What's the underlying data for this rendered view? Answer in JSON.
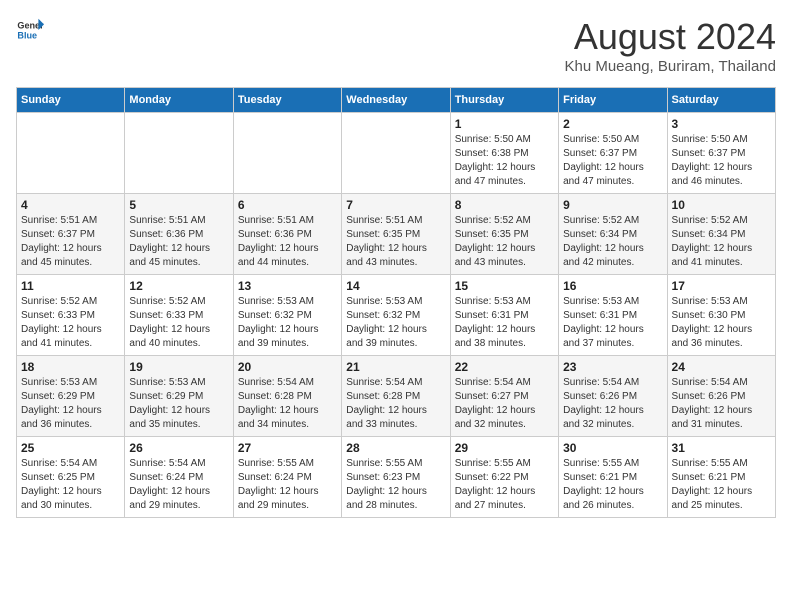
{
  "header": {
    "logo_general": "General",
    "logo_blue": "Blue",
    "month_title": "August 2024",
    "location": "Khu Mueang, Buriram, Thailand"
  },
  "weekdays": [
    "Sunday",
    "Monday",
    "Tuesday",
    "Wednesday",
    "Thursday",
    "Friday",
    "Saturday"
  ],
  "weeks": [
    [
      {
        "day": "",
        "info": ""
      },
      {
        "day": "",
        "info": ""
      },
      {
        "day": "",
        "info": ""
      },
      {
        "day": "",
        "info": ""
      },
      {
        "day": "1",
        "info": "Sunrise: 5:50 AM\nSunset: 6:38 PM\nDaylight: 12 hours\nand 47 minutes."
      },
      {
        "day": "2",
        "info": "Sunrise: 5:50 AM\nSunset: 6:37 PM\nDaylight: 12 hours\nand 47 minutes."
      },
      {
        "day": "3",
        "info": "Sunrise: 5:50 AM\nSunset: 6:37 PM\nDaylight: 12 hours\nand 46 minutes."
      }
    ],
    [
      {
        "day": "4",
        "info": "Sunrise: 5:51 AM\nSunset: 6:37 PM\nDaylight: 12 hours\nand 45 minutes."
      },
      {
        "day": "5",
        "info": "Sunrise: 5:51 AM\nSunset: 6:36 PM\nDaylight: 12 hours\nand 45 minutes."
      },
      {
        "day": "6",
        "info": "Sunrise: 5:51 AM\nSunset: 6:36 PM\nDaylight: 12 hours\nand 44 minutes."
      },
      {
        "day": "7",
        "info": "Sunrise: 5:51 AM\nSunset: 6:35 PM\nDaylight: 12 hours\nand 43 minutes."
      },
      {
        "day": "8",
        "info": "Sunrise: 5:52 AM\nSunset: 6:35 PM\nDaylight: 12 hours\nand 43 minutes."
      },
      {
        "day": "9",
        "info": "Sunrise: 5:52 AM\nSunset: 6:34 PM\nDaylight: 12 hours\nand 42 minutes."
      },
      {
        "day": "10",
        "info": "Sunrise: 5:52 AM\nSunset: 6:34 PM\nDaylight: 12 hours\nand 41 minutes."
      }
    ],
    [
      {
        "day": "11",
        "info": "Sunrise: 5:52 AM\nSunset: 6:33 PM\nDaylight: 12 hours\nand 41 minutes."
      },
      {
        "day": "12",
        "info": "Sunrise: 5:52 AM\nSunset: 6:33 PM\nDaylight: 12 hours\nand 40 minutes."
      },
      {
        "day": "13",
        "info": "Sunrise: 5:53 AM\nSunset: 6:32 PM\nDaylight: 12 hours\nand 39 minutes."
      },
      {
        "day": "14",
        "info": "Sunrise: 5:53 AM\nSunset: 6:32 PM\nDaylight: 12 hours\nand 39 minutes."
      },
      {
        "day": "15",
        "info": "Sunrise: 5:53 AM\nSunset: 6:31 PM\nDaylight: 12 hours\nand 38 minutes."
      },
      {
        "day": "16",
        "info": "Sunrise: 5:53 AM\nSunset: 6:31 PM\nDaylight: 12 hours\nand 37 minutes."
      },
      {
        "day": "17",
        "info": "Sunrise: 5:53 AM\nSunset: 6:30 PM\nDaylight: 12 hours\nand 36 minutes."
      }
    ],
    [
      {
        "day": "18",
        "info": "Sunrise: 5:53 AM\nSunset: 6:29 PM\nDaylight: 12 hours\nand 36 minutes."
      },
      {
        "day": "19",
        "info": "Sunrise: 5:53 AM\nSunset: 6:29 PM\nDaylight: 12 hours\nand 35 minutes."
      },
      {
        "day": "20",
        "info": "Sunrise: 5:54 AM\nSunset: 6:28 PM\nDaylight: 12 hours\nand 34 minutes."
      },
      {
        "day": "21",
        "info": "Sunrise: 5:54 AM\nSunset: 6:28 PM\nDaylight: 12 hours\nand 33 minutes."
      },
      {
        "day": "22",
        "info": "Sunrise: 5:54 AM\nSunset: 6:27 PM\nDaylight: 12 hours\nand 32 minutes."
      },
      {
        "day": "23",
        "info": "Sunrise: 5:54 AM\nSunset: 6:26 PM\nDaylight: 12 hours\nand 32 minutes."
      },
      {
        "day": "24",
        "info": "Sunrise: 5:54 AM\nSunset: 6:26 PM\nDaylight: 12 hours\nand 31 minutes."
      }
    ],
    [
      {
        "day": "25",
        "info": "Sunrise: 5:54 AM\nSunset: 6:25 PM\nDaylight: 12 hours\nand 30 minutes."
      },
      {
        "day": "26",
        "info": "Sunrise: 5:54 AM\nSunset: 6:24 PM\nDaylight: 12 hours\nand 29 minutes."
      },
      {
        "day": "27",
        "info": "Sunrise: 5:55 AM\nSunset: 6:24 PM\nDaylight: 12 hours\nand 29 minutes."
      },
      {
        "day": "28",
        "info": "Sunrise: 5:55 AM\nSunset: 6:23 PM\nDaylight: 12 hours\nand 28 minutes."
      },
      {
        "day": "29",
        "info": "Sunrise: 5:55 AM\nSunset: 6:22 PM\nDaylight: 12 hours\nand 27 minutes."
      },
      {
        "day": "30",
        "info": "Sunrise: 5:55 AM\nSunset: 6:21 PM\nDaylight: 12 hours\nand 26 minutes."
      },
      {
        "day": "31",
        "info": "Sunrise: 5:55 AM\nSunset: 6:21 PM\nDaylight: 12 hours\nand 25 minutes."
      }
    ]
  ]
}
